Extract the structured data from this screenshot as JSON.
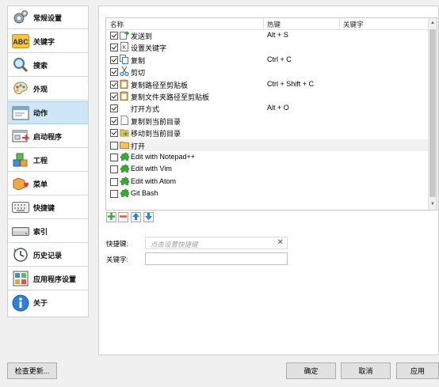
{
  "sidebar": {
    "items": [
      {
        "label": "常规设置",
        "icon": "gears-icon"
      },
      {
        "label": "关键字",
        "icon": "abc-keyword-icon"
      },
      {
        "label": "搜索",
        "icon": "magnifier-icon"
      },
      {
        "label": "外观",
        "icon": "palette-icon"
      },
      {
        "label": "动作",
        "icon": "action-window-icon"
      },
      {
        "label": "启动程序",
        "icon": "launch-icon"
      },
      {
        "label": "工程",
        "icon": "cubes-icon"
      },
      {
        "label": "菜单",
        "icon": "menu-heart-icon"
      },
      {
        "label": "快捷键",
        "icon": "keyboard-icon"
      },
      {
        "label": "索引",
        "icon": "disk-icon"
      },
      {
        "label": "历史记录",
        "icon": "clock-icon"
      },
      {
        "label": "应用程序设置",
        "icon": "app-grid-icon"
      },
      {
        "label": "关于",
        "icon": "info-icon"
      }
    ],
    "selected_index": 4
  },
  "actions_table": {
    "columns": [
      "名称",
      "热键",
      "关键字"
    ],
    "rows": [
      {
        "checked": true,
        "icon": "send-to-icon",
        "name": "发送到",
        "hotkey": "Alt + S",
        "keyword": ""
      },
      {
        "checked": true,
        "icon": "keyword-icon",
        "name": "设置关键字",
        "hotkey": "",
        "keyword": ""
      },
      {
        "checked": true,
        "icon": "copy-icon",
        "name": "复制",
        "hotkey": "Ctrl + C",
        "keyword": ""
      },
      {
        "checked": true,
        "icon": "cut-icon",
        "name": "剪切",
        "hotkey": "",
        "keyword": ""
      },
      {
        "checked": true,
        "icon": "clipboard-icon",
        "name": "复制路径至剪贴板",
        "hotkey": "Ctrl + Shift + C",
        "keyword": ""
      },
      {
        "checked": true,
        "icon": "clipboard-icon",
        "name": "复制文件夹路径至剪贴板",
        "hotkey": "",
        "keyword": ""
      },
      {
        "checked": true,
        "icon": "",
        "name": "打开方式",
        "hotkey": "Alt + O",
        "keyword": ""
      },
      {
        "checked": true,
        "icon": "document-icon",
        "name": "复制到当前目录",
        "hotkey": "",
        "keyword": ""
      },
      {
        "checked": true,
        "icon": "move-icon",
        "name": "移动到当前目录",
        "hotkey": "",
        "keyword": ""
      },
      {
        "checked": false,
        "icon": "folder-icon",
        "name": "打开",
        "hotkey": "",
        "keyword": ""
      },
      {
        "checked": false,
        "icon": "plugin-icon",
        "name": "Edit with Notepad++",
        "hotkey": "",
        "keyword": ""
      },
      {
        "checked": false,
        "icon": "plugin-icon",
        "name": "Edit with Vim",
        "hotkey": "",
        "keyword": ""
      },
      {
        "checked": false,
        "icon": "plugin-icon",
        "name": "Edit with Atom",
        "hotkey": "",
        "keyword": ""
      },
      {
        "checked": false,
        "icon": "plugin-icon",
        "name": "Git Bash",
        "hotkey": "",
        "keyword": ""
      }
    ],
    "selected_row": 9
  },
  "toolbar": {
    "add": "add-icon",
    "remove": "remove-icon",
    "up": "arrow-up-icon",
    "down": "arrow-down-icon"
  },
  "form": {
    "hotkey_label": "快捷键:",
    "hotkey_placeholder": "点击设置快捷键",
    "keyword_label": "关键字:",
    "keyword_value": ""
  },
  "buttons": {
    "check_updates": "检查更新...",
    "ok": "确定",
    "cancel": "取消",
    "apply": "应用"
  },
  "colors": {
    "selection": "#cfe6f7",
    "plugin_green": "#3aa63a"
  }
}
